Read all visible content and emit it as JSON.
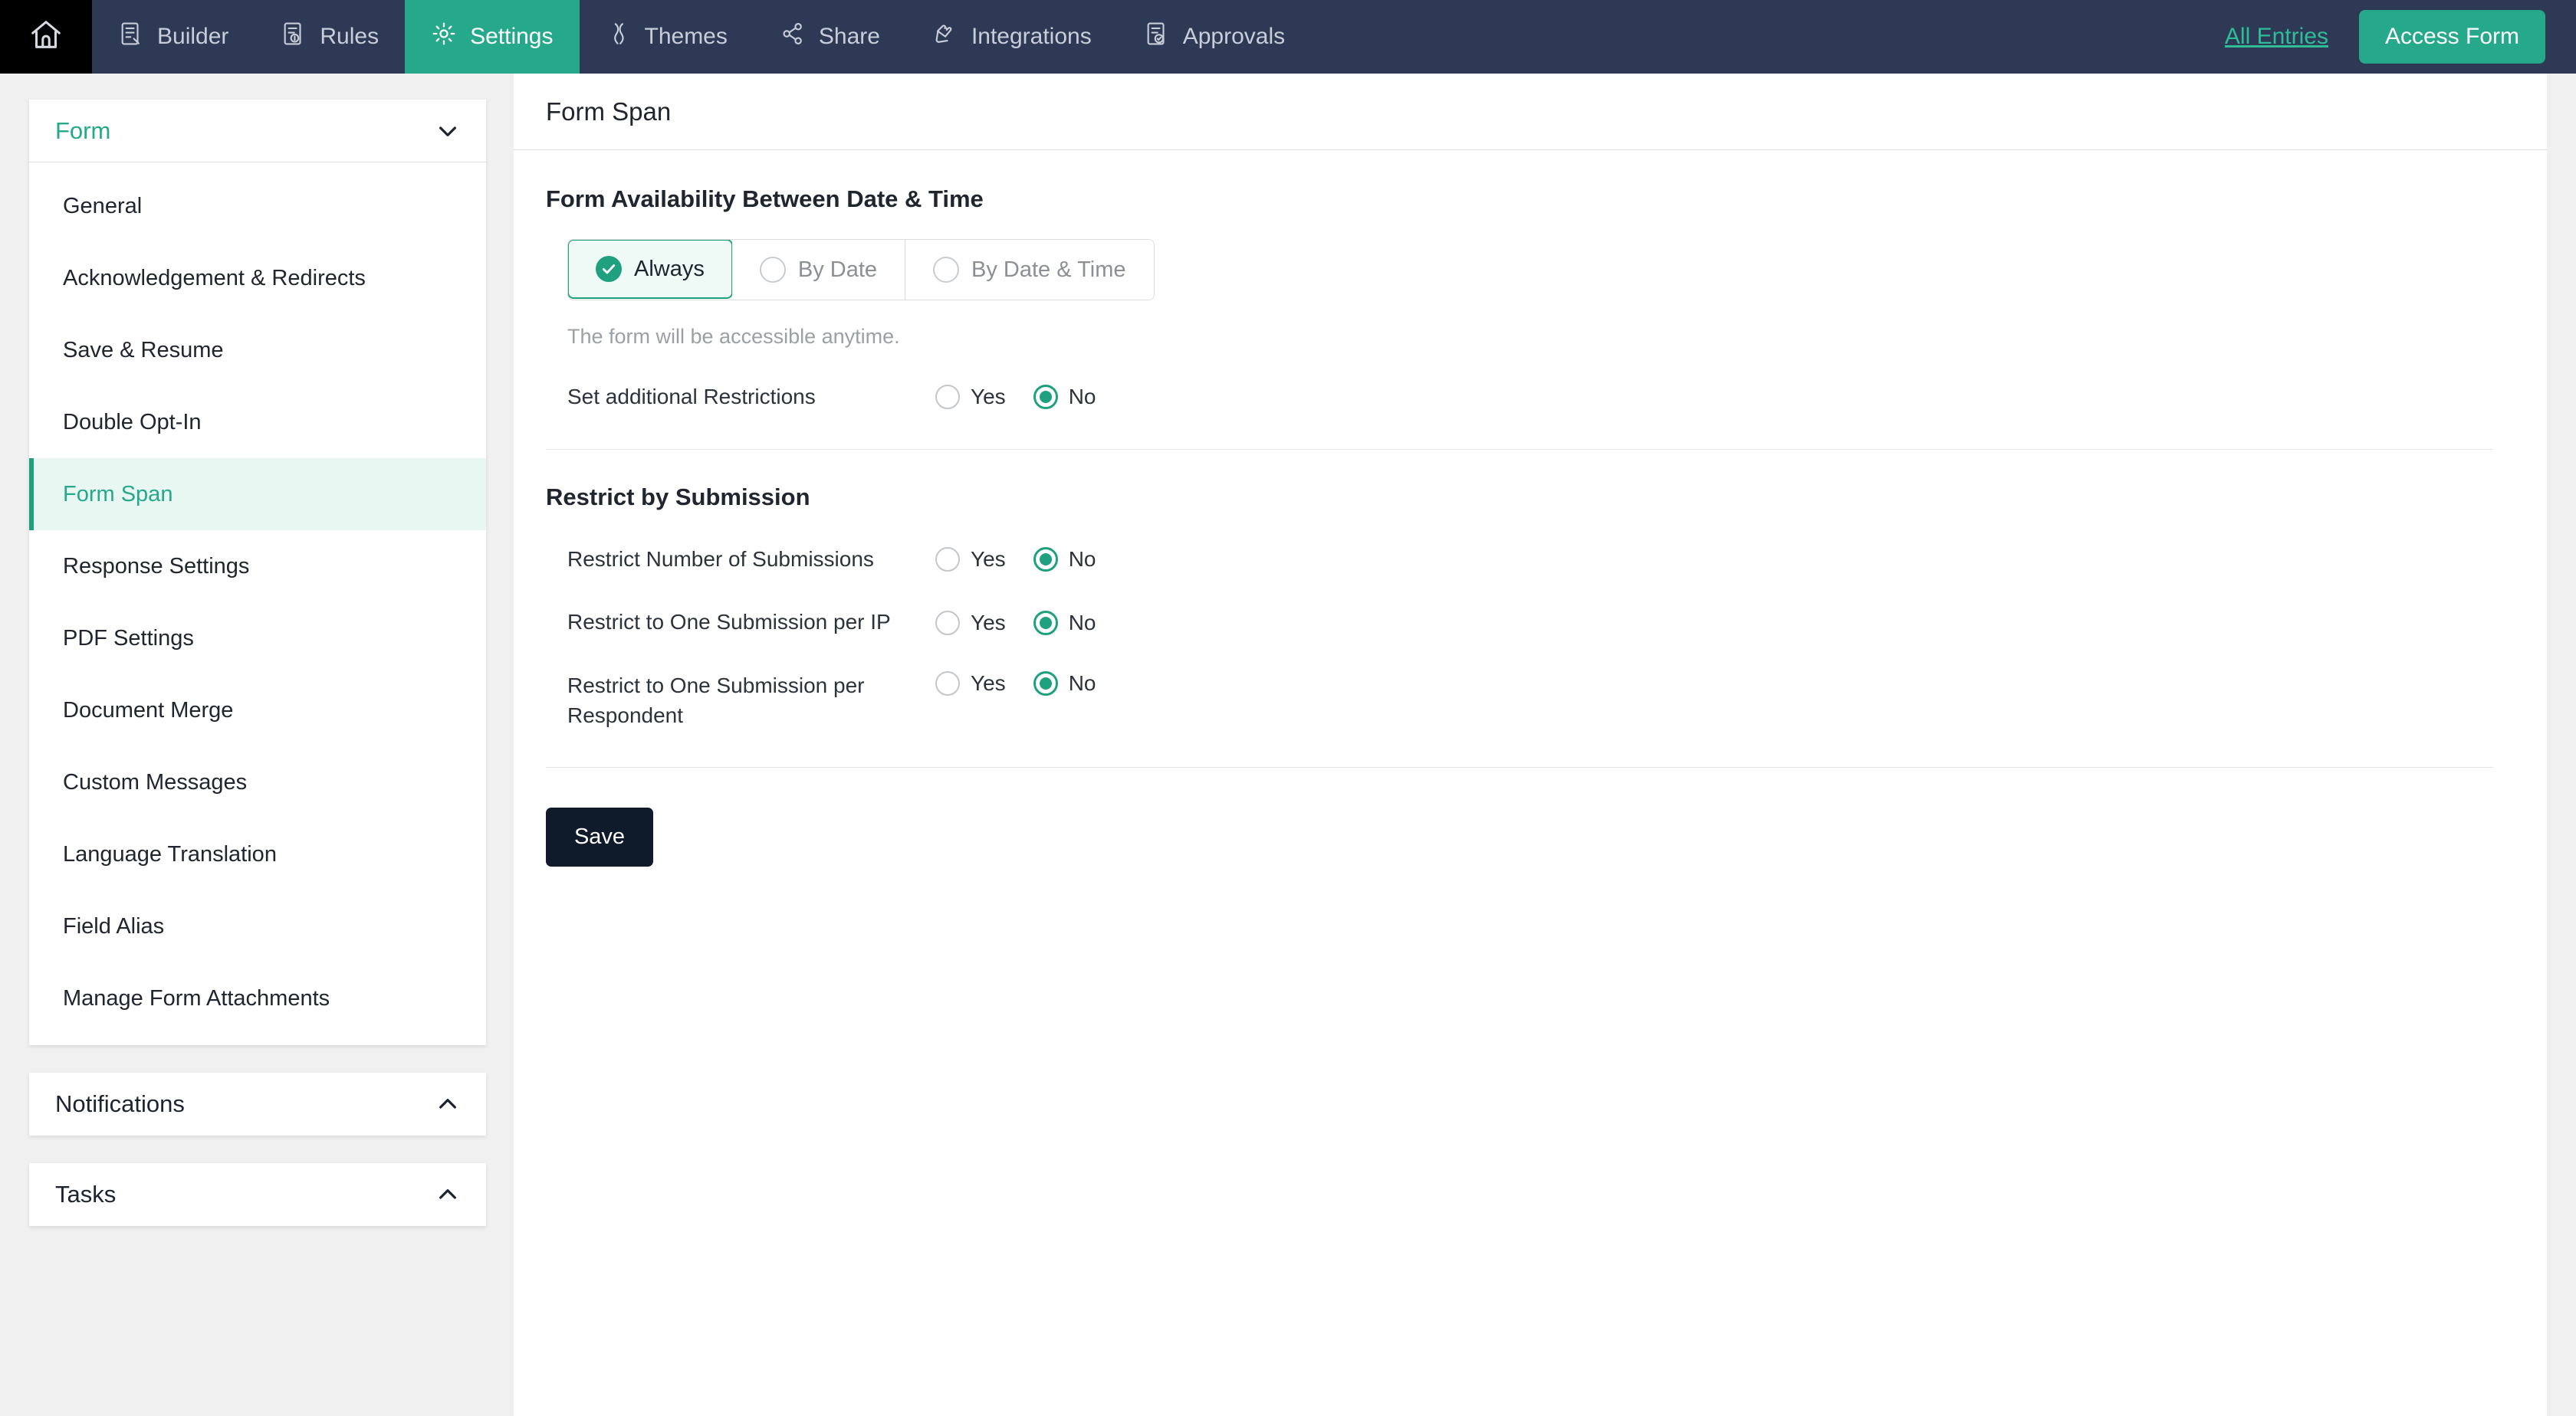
{
  "topnav": {
    "home_icon": "home-icon",
    "tabs": [
      {
        "label": "Builder",
        "icon": "builder-icon",
        "active": false
      },
      {
        "label": "Rules",
        "icon": "rules-icon",
        "active": false
      },
      {
        "label": "Settings",
        "icon": "gear-icon",
        "active": true
      },
      {
        "label": "Themes",
        "icon": "themes-icon",
        "active": false
      },
      {
        "label": "Share",
        "icon": "share-icon",
        "active": false
      },
      {
        "label": "Integrations",
        "icon": "integrations-icon",
        "active": false
      },
      {
        "label": "Approvals",
        "icon": "approvals-icon",
        "active": false
      }
    ],
    "all_entries_link": "All Entries",
    "access_form_button": "Access Form",
    "accent_color": "#26a98a",
    "bar_color": "#2e3a55"
  },
  "sidebar": {
    "groups": [
      {
        "title": "Form",
        "expanded": true,
        "chevron": "chevron-down-icon",
        "items": [
          {
            "label": "General",
            "selected": false
          },
          {
            "label": "Acknowledgement & Redirects",
            "selected": false
          },
          {
            "label": "Save & Resume",
            "selected": false
          },
          {
            "label": "Double Opt-In",
            "selected": false
          },
          {
            "label": "Form Span",
            "selected": true
          },
          {
            "label": "Response Settings",
            "selected": false
          },
          {
            "label": "PDF Settings",
            "selected": false
          },
          {
            "label": "Document Merge",
            "selected": false
          },
          {
            "label": "Custom Messages",
            "selected": false
          },
          {
            "label": "Language Translation",
            "selected": false
          },
          {
            "label": "Field Alias",
            "selected": false
          },
          {
            "label": "Manage Form Attachments",
            "selected": false
          }
        ]
      },
      {
        "title": "Notifications",
        "expanded": false,
        "chevron": "chevron-up-icon",
        "items": []
      },
      {
        "title": "Tasks",
        "expanded": false,
        "chevron": "chevron-up-icon",
        "items": []
      }
    ]
  },
  "main": {
    "page_title": "Form Span",
    "availability": {
      "section_title": "Form Availability Between Date & Time",
      "options": [
        {
          "label": "Always",
          "selected": true
        },
        {
          "label": "By Date",
          "selected": false
        },
        {
          "label": "By Date & Time",
          "selected": false
        }
      ],
      "helper_text": "The form will be accessible anytime.",
      "additional": {
        "label": "Set additional Restrictions",
        "yes_label": "Yes",
        "no_label": "No",
        "value": "No"
      }
    },
    "restrict": {
      "section_title": "Restrict by Submission",
      "rows": [
        {
          "label": "Restrict Number of Submissions",
          "yes_label": "Yes",
          "no_label": "No",
          "value": "No"
        },
        {
          "label": "Restrict to One Submission per IP",
          "yes_label": "Yes",
          "no_label": "No",
          "value": "No"
        },
        {
          "label": "Restrict to One Submission per Respondent",
          "yes_label": "Yes",
          "no_label": "No",
          "value": "No"
        }
      ]
    },
    "save_button": "Save"
  }
}
